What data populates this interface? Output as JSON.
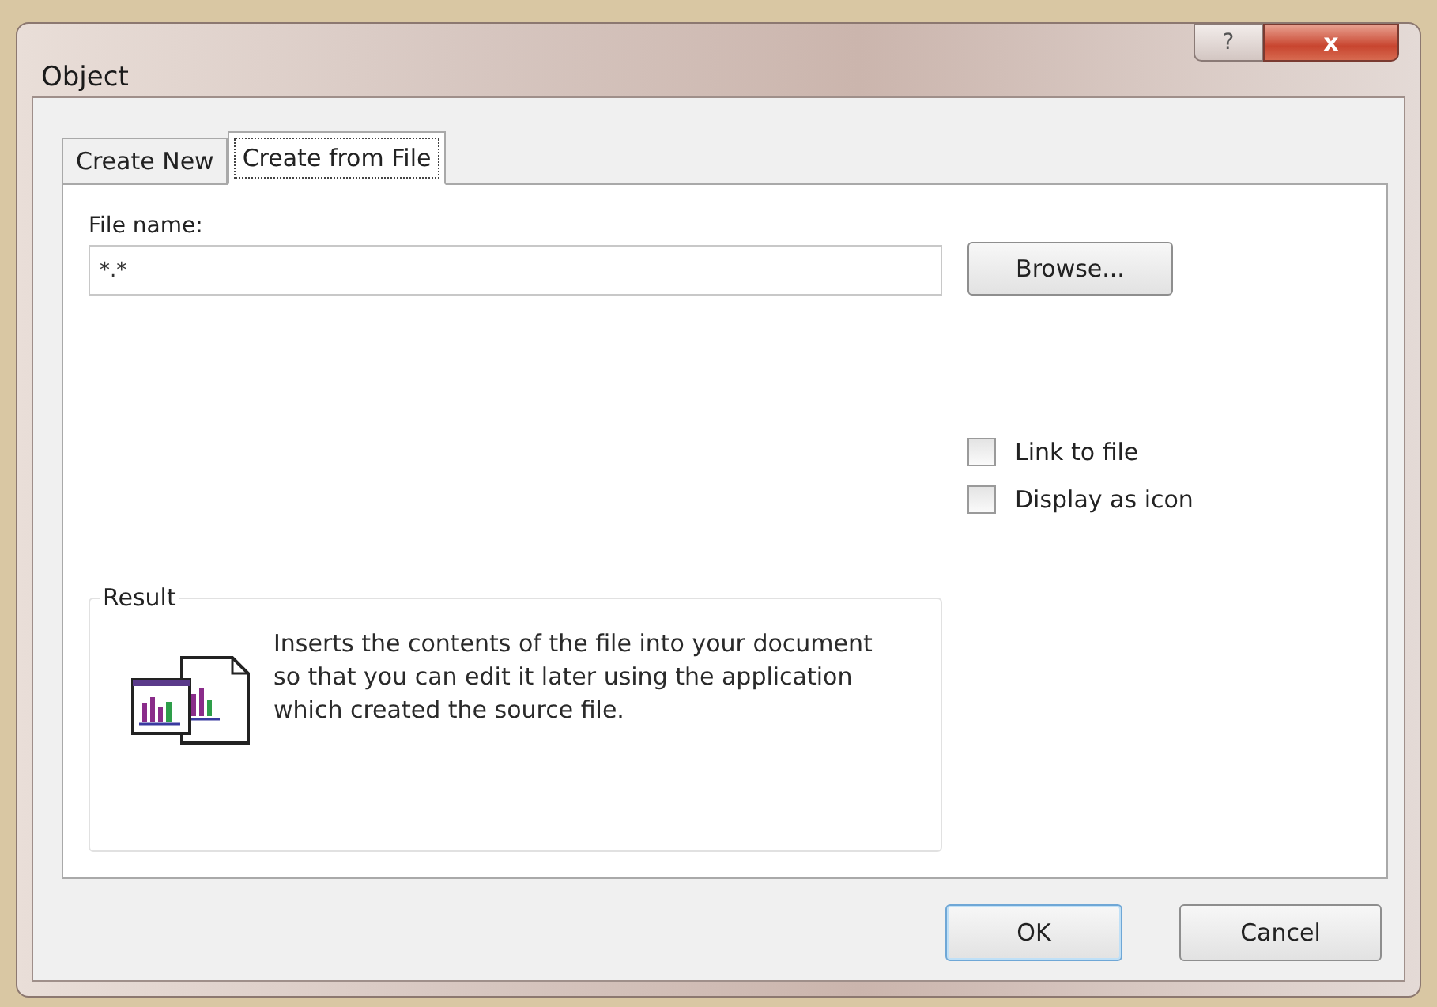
{
  "window": {
    "title": "Object",
    "help_button": "?",
    "close_button": "x"
  },
  "tabs": [
    {
      "label": "Create New",
      "selected": false
    },
    {
      "label": "Create from File",
      "selected": true
    }
  ],
  "file_name": {
    "label": "File name:",
    "value": "*.*"
  },
  "browse_button": "Browse...",
  "options": [
    {
      "label": "Link to file",
      "checked": false
    },
    {
      "label": "Display as icon",
      "checked": false
    }
  ],
  "result": {
    "title": "Result",
    "text": "Inserts the contents of the file into your document so that you can edit it later using the application which created the source file."
  },
  "buttons": [
    {
      "label": "OK",
      "default": true
    },
    {
      "label": "Cancel",
      "default": false
    }
  ]
}
